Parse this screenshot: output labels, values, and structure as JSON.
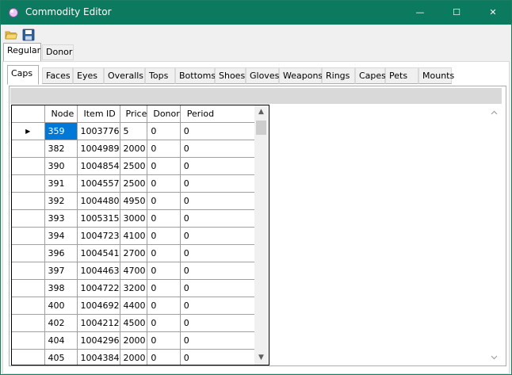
{
  "window": {
    "title": "Commodity Editor",
    "controls": {
      "minimize": "—",
      "maximize": "☐",
      "close": "✕"
    },
    "accent_color": "#0b7a5e"
  },
  "toolbar": {
    "icons": [
      "open-folder-icon",
      "save-disk-icon"
    ]
  },
  "main_tabs": [
    {
      "label": "Regular",
      "active": true
    },
    {
      "label": "Donor",
      "active": false
    }
  ],
  "sub_tabs": [
    {
      "label": "Caps",
      "active": true
    },
    {
      "label": "Faces",
      "active": false
    },
    {
      "label": "Eyes",
      "active": false
    },
    {
      "label": "Overalls",
      "active": false
    },
    {
      "label": "Tops",
      "active": false
    },
    {
      "label": "Bottoms",
      "active": false
    },
    {
      "label": "Shoes",
      "active": false
    },
    {
      "label": "Gloves",
      "active": false
    },
    {
      "label": "Weapons",
      "active": false
    },
    {
      "label": "Rings",
      "active": false
    },
    {
      "label": "Capes",
      "active": false
    },
    {
      "label": "Pets",
      "active": false
    },
    {
      "label": "Mounts",
      "active": false
    }
  ],
  "grid": {
    "columns": [
      "Node",
      "Item ID",
      "Price",
      "Donor",
      "Period"
    ],
    "current_row_marker": "▶",
    "selected_cell": "359",
    "rows": [
      [
        "359",
        "1003776",
        "5",
        "0",
        "0"
      ],
      [
        "382",
        "1004989",
        "2000",
        "0",
        "0"
      ],
      [
        "390",
        "1004854",
        "2500",
        "0",
        "0"
      ],
      [
        "391",
        "1004557",
        "2500",
        "0",
        "0"
      ],
      [
        "392",
        "1004480",
        "4950",
        "0",
        "0"
      ],
      [
        "393",
        "1005315",
        "3000",
        "0",
        "0"
      ],
      [
        "394",
        "1004723",
        "4100",
        "0",
        "0"
      ],
      [
        "396",
        "1004541",
        "2700",
        "0",
        "0"
      ],
      [
        "397",
        "1004463",
        "4700",
        "0",
        "0"
      ],
      [
        "398",
        "1004722",
        "3200",
        "0",
        "0"
      ],
      [
        "400",
        "1004692",
        "4400",
        "0",
        "0"
      ],
      [
        "402",
        "1004212",
        "4500",
        "0",
        "0"
      ],
      [
        "404",
        "1004296",
        "2000",
        "0",
        "0"
      ],
      [
        "405",
        "1004384",
        "2000",
        "0",
        "0"
      ]
    ]
  },
  "scroll_arrows": {
    "up": "▲",
    "down": "▼"
  }
}
